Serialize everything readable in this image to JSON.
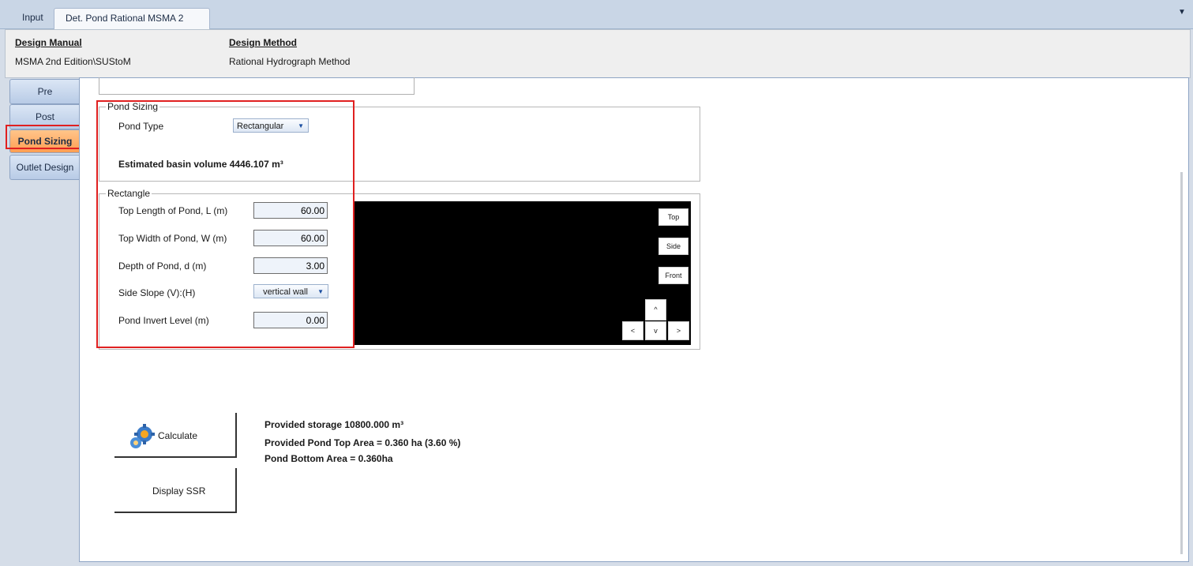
{
  "tabs": {
    "input": "Input",
    "active": "Det. Pond Rational MSMA 2",
    "dropdown_icon": "▼"
  },
  "header": {
    "design_manual_title": "Design Manual",
    "design_manual_value": "MSMA 2nd Edition\\SUStoM",
    "design_method_title": "Design Method",
    "design_method_value": "Rational Hydrograph Method"
  },
  "side_tabs": {
    "pre": "Pre",
    "post": "Post",
    "pond_sizing": "Pond Sizing",
    "outlet_design": "Outlet Design"
  },
  "pond_sizing": {
    "legend": "Pond Sizing",
    "pond_type_label": "Pond Type",
    "pond_type_value": "Rectangular",
    "estimated_volume": "Estimated basin volume 4446.107 m³"
  },
  "rectangle": {
    "legend": "Rectangle",
    "top_length_label": "Top Length of Pond, L (m)",
    "top_length_value": "60.00",
    "top_width_label": "Top Width of Pond, W (m)",
    "top_width_value": "60.00",
    "depth_label": "Depth of Pond, d (m)",
    "depth_value": "3.00",
    "side_slope_label": "Side Slope (V):(H)",
    "side_slope_value": "vertical wall",
    "invert_label": "Pond Invert Level (m)",
    "invert_value": "0.00"
  },
  "viewer": {
    "top": "Top",
    "side": "Side",
    "front": "Front",
    "up": "^",
    "down": "v",
    "left": "<",
    "right": ">"
  },
  "actions": {
    "calculate": "Calculate",
    "display_ssr": "Display SSR"
  },
  "results": {
    "storage": "Provided storage 10800.000 m³",
    "top_area": "Provided Pond Top Area = 0.360 ha (3.60 %)",
    "bottom_area": "Pond Bottom Area = 0.360ha"
  },
  "colors": {
    "highlight_border": "#e02020",
    "active_tab": "#ff9e52"
  }
}
